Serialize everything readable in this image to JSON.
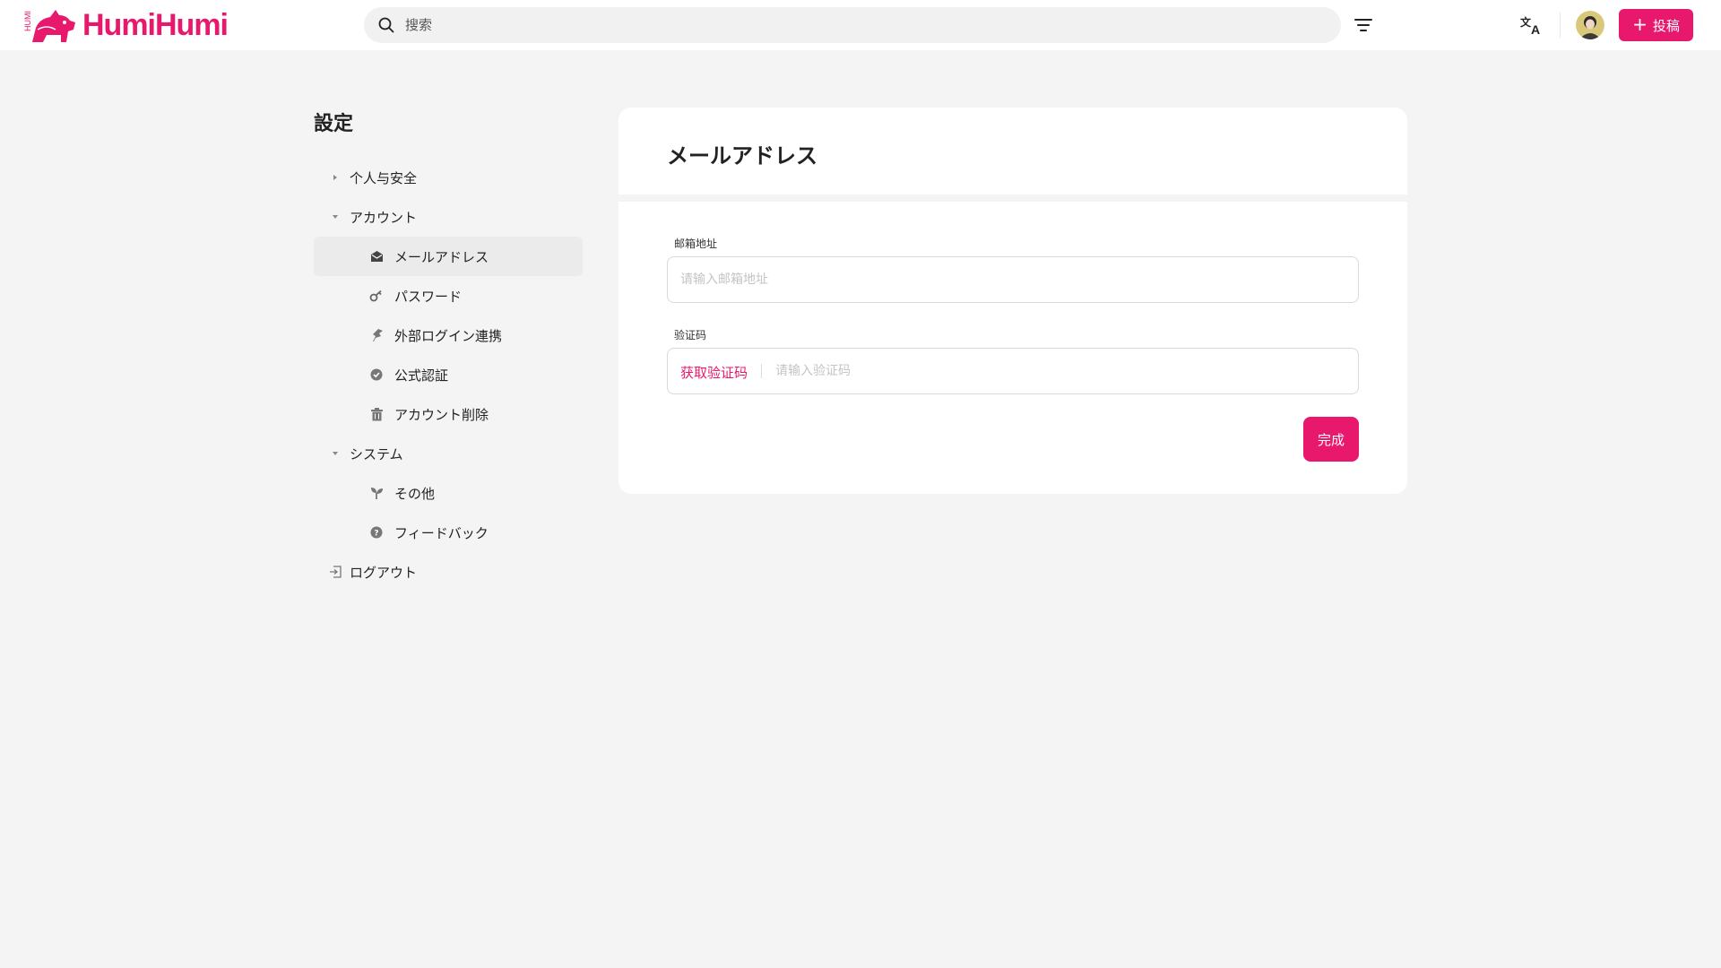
{
  "brand": {
    "name": "HumiHumi",
    "accent_color": "#e8196d"
  },
  "header": {
    "search_placeholder": "搜索",
    "post_label": "投稿",
    "icons": [
      "search-icon",
      "filter-icon",
      "translate-icon",
      "avatar",
      "plus-icon"
    ]
  },
  "sidebar": {
    "title": "設定",
    "items": [
      {
        "label": "个人与安全",
        "level": 1,
        "icon": "caret-right-icon",
        "expanded": false
      },
      {
        "label": "アカウント",
        "level": 1,
        "icon": "caret-down-icon",
        "expanded": true
      },
      {
        "label": "メールアドレス",
        "level": 2,
        "icon": "mail-icon",
        "active": true
      },
      {
        "label": "パスワード",
        "level": 2,
        "icon": "key-icon"
      },
      {
        "label": "外部ログイン連携",
        "level": 2,
        "icon": "link-icon"
      },
      {
        "label": "公式認証",
        "level": 2,
        "icon": "verified-icon"
      },
      {
        "label": "アカウント削除",
        "level": 2,
        "icon": "trash-icon"
      },
      {
        "label": "システム",
        "level": 1,
        "icon": "caret-down-icon",
        "expanded": true
      },
      {
        "label": "その他",
        "level": 2,
        "icon": "sprout-icon"
      },
      {
        "label": "フィードバック",
        "level": 2,
        "icon": "help-icon"
      },
      {
        "label": "ログアウト",
        "level": 1,
        "icon": "logout-icon"
      }
    ]
  },
  "content": {
    "title": "メールアドレス",
    "email_label": "邮箱地址",
    "email_value": "",
    "email_placeholder": "请输入邮箱地址",
    "code_label": "验证码",
    "get_code_label": "获取验证码",
    "code_value": "",
    "code_placeholder": "请输入验证码",
    "done_label": "完成"
  }
}
